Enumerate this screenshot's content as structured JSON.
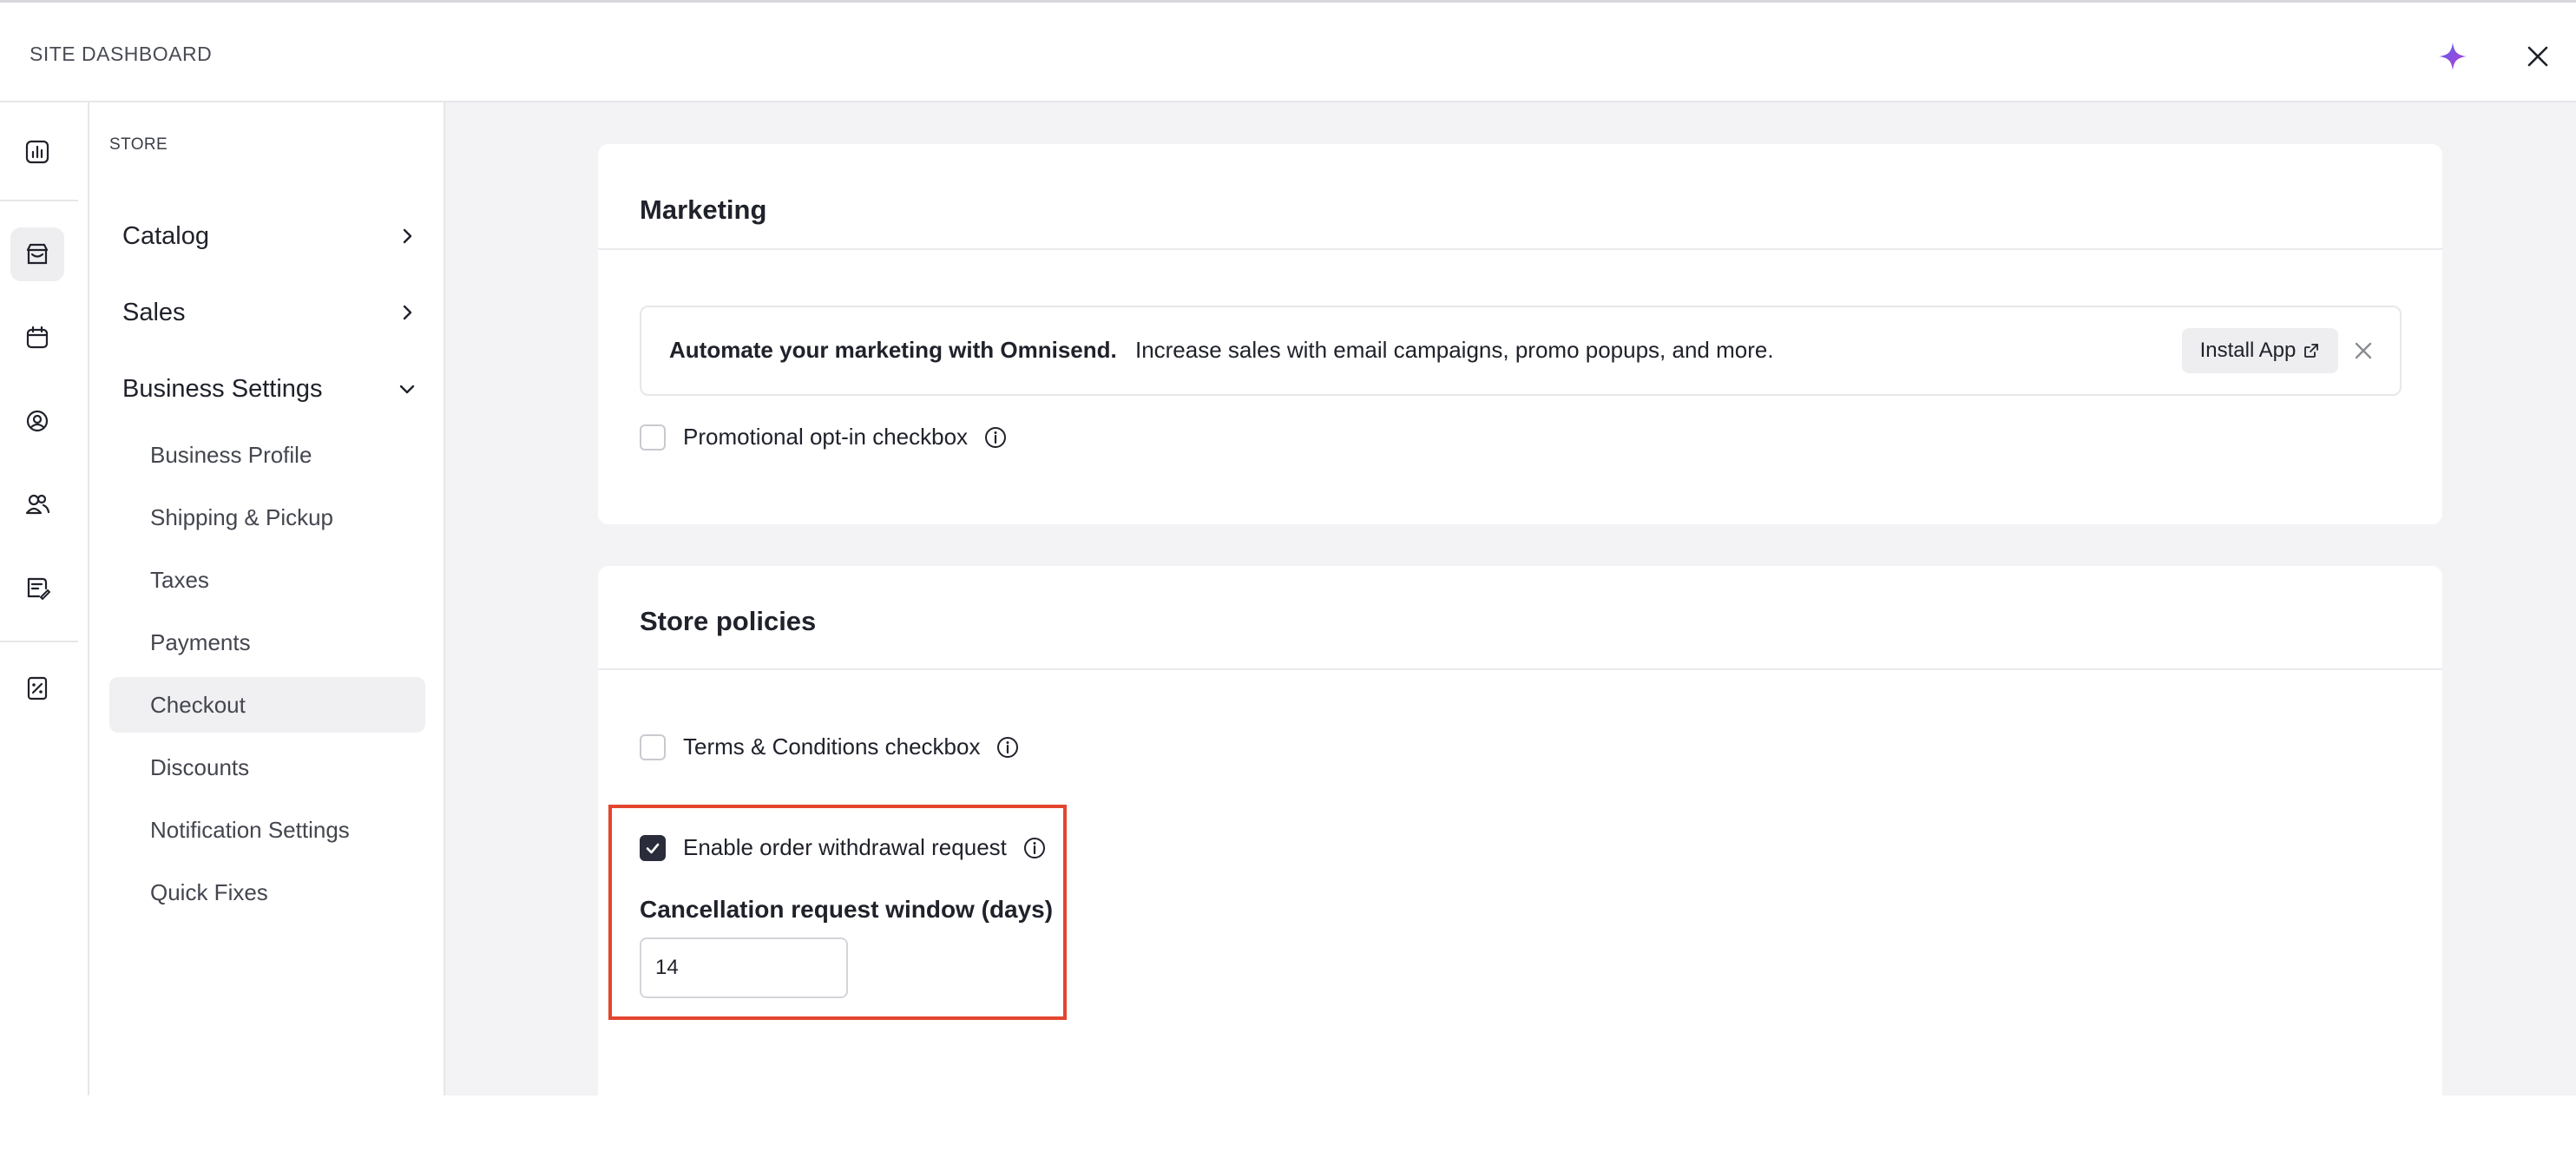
{
  "header": {
    "title": "SITE DASHBOARD",
    "accent_color": "#8b3fd9"
  },
  "rail": {
    "icons": [
      "analytics-icon",
      "store-icon",
      "calendar-icon",
      "contacts-icon",
      "members-icon",
      "blog-icon",
      "reports-icon"
    ],
    "active": "store-icon"
  },
  "sidenav": {
    "heading": "STORE",
    "groups": [
      {
        "label": "Catalog",
        "expanded": false
      },
      {
        "label": "Sales",
        "expanded": false
      },
      {
        "label": "Business Settings",
        "expanded": true
      }
    ],
    "items": [
      {
        "label": "Business Profile"
      },
      {
        "label": "Shipping & Pickup"
      },
      {
        "label": "Taxes"
      },
      {
        "label": "Payments"
      },
      {
        "label": "Checkout",
        "active": true
      },
      {
        "label": "Discounts"
      },
      {
        "label": "Notification Settings"
      },
      {
        "label": "Quick Fixes"
      }
    ]
  },
  "marketing": {
    "title": "Marketing",
    "promo": {
      "strong_text": "Automate your marketing with Omnisend.",
      "text": "Increase sales with email campaigns, promo popups, and more.",
      "button_label": "Install App"
    },
    "optin_label": "Promotional opt-in checkbox",
    "optin_checked": false
  },
  "policies": {
    "title": "Store policies",
    "terms_label": "Terms & Conditions checkbox",
    "terms_checked": false,
    "withdrawal_label": "Enable order withdrawal request",
    "withdrawal_checked": true,
    "window_label": "Cancellation request window (days)",
    "window_value": "14",
    "highlight_color": "#e3452f"
  }
}
